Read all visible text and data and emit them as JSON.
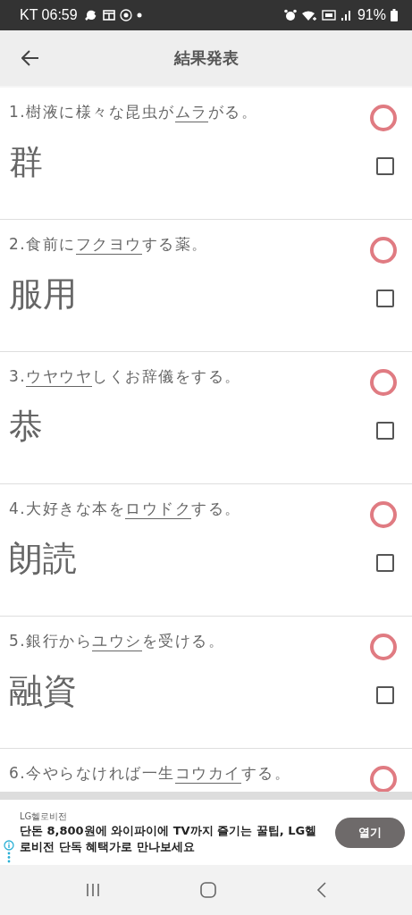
{
  "status_bar": {
    "carrier_time": "KT 06:59",
    "battery": "91%"
  },
  "app_bar": {
    "title": "結果発表"
  },
  "questions": [
    {
      "number": "1.",
      "before": "樹液に様々な昆虫が",
      "underlined": "ムラ",
      "after": "がる。",
      "kind": "circle",
      "answer": "群",
      "checked": false
    },
    {
      "number": "2.",
      "before": "食前に",
      "underlined": "フクヨウ",
      "after": "する薬。",
      "kind": "circle",
      "answer": "服用",
      "checked": false
    },
    {
      "number": "3.",
      "underlined": "ウヤウヤ",
      "after": "しくお辞儀をする。",
      "kind": "circle",
      "answer": "恭",
      "checked": false
    },
    {
      "number": "4.",
      "before": "大好きな本を",
      "underlined": "ロウドク",
      "after": "する。",
      "kind": "circle",
      "answer": "朗読",
      "checked": false
    },
    {
      "number": "5.",
      "before": "銀行から",
      "underlined": "ユウシ",
      "after": "を受ける。",
      "kind": "circle",
      "answer": "融資",
      "checked": false
    },
    {
      "number": "6.",
      "before": "今やらなければ一生",
      "underlined": "コウカイ",
      "after": "する。",
      "kind": "circle"
    }
  ],
  "ad": {
    "advertiser": "LG헬로비전",
    "text": "단돈 8,800원에 와이파이에 TV까지 즐기는 꿀팁, LG헬로비전 단독 혜택가로 만나보세요",
    "button": "열기"
  }
}
